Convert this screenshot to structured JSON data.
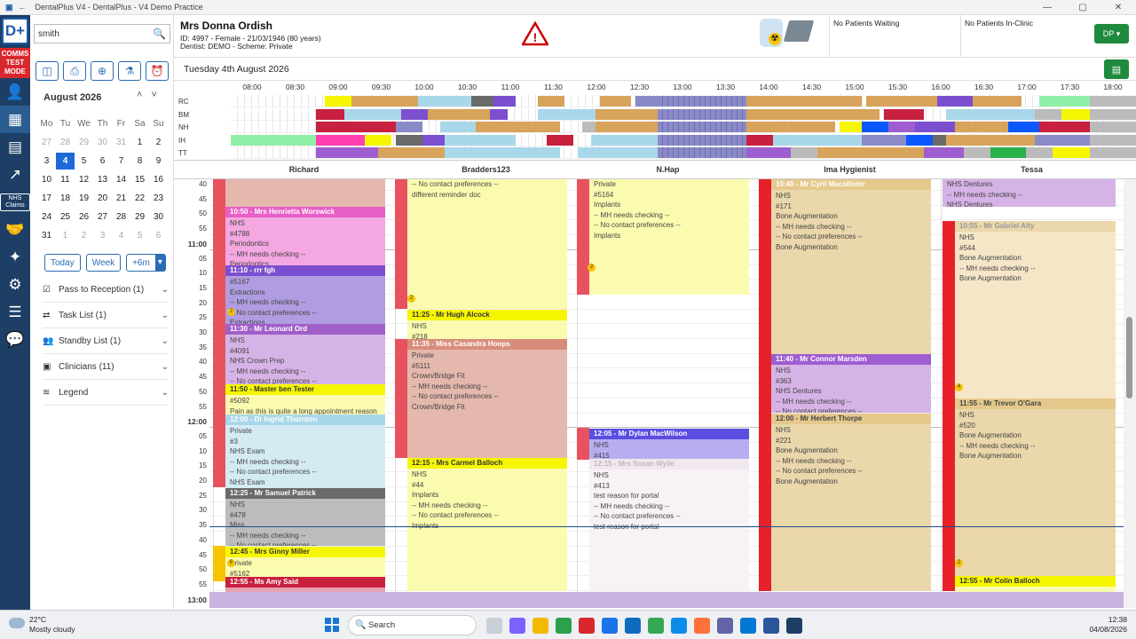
{
  "window": {
    "title": "DentalPlus V4 - DentalPlus - V4 Demo Practice"
  },
  "sidebar": {
    "comms_label": "COMMS TEST MODE",
    "nhs_label": "NHS Claims"
  },
  "search": {
    "value": "smith"
  },
  "calendar": {
    "month_label": "August 2026",
    "weekdays": [
      "Mo",
      "Tu",
      "We",
      "Th",
      "Fr",
      "Sa",
      "Su"
    ],
    "weeks": [
      [
        "27",
        "28",
        "29",
        "30",
        "31",
        "1",
        "2"
      ],
      [
        "3",
        "4",
        "5",
        "6",
        "7",
        "8",
        "9"
      ],
      [
        "10",
        "11",
        "12",
        "13",
        "14",
        "15",
        "16"
      ],
      [
        "17",
        "18",
        "19",
        "20",
        "21",
        "22",
        "23"
      ],
      [
        "24",
        "25",
        "26",
        "27",
        "28",
        "29",
        "30"
      ],
      [
        "31",
        "1",
        "2",
        "3",
        "4",
        "5",
        "6"
      ]
    ]
  },
  "nav": {
    "today": "Today",
    "week": "Week",
    "plus": "+6m"
  },
  "panels": [
    {
      "label": "Pass to Reception (1)"
    },
    {
      "label": "Task List (1)"
    },
    {
      "label": "Standby List (1)"
    },
    {
      "label": "Clinicians (11)"
    },
    {
      "label": "Legend"
    }
  ],
  "patient": {
    "name": "Mrs Donna Ordish",
    "line1": "ID: 4997 - Female - 21/03/1946 (80 years)",
    "line2": "Dentist: DEMO - Scheme: Private"
  },
  "waiting": {
    "waiting": "No Patients Waiting",
    "inclinic": "No Patients In-Clinic"
  },
  "user": {
    "initials": "DP"
  },
  "date_label": "Tuesday 4th August 2026",
  "timeline": {
    "hours": [
      "08:00",
      "08:30",
      "09:00",
      "09:30",
      "10:00",
      "10:30",
      "11:00",
      "11:30",
      "12:00",
      "12:30",
      "13:00",
      "13:30",
      "14:00",
      "14:30",
      "15:00",
      "15:30",
      "16:00",
      "16:30",
      "17:00",
      "17:30",
      "18:00"
    ],
    "rows": [
      "RC",
      "BM",
      "NH",
      "IH",
      "TT"
    ]
  },
  "columns": [
    "Richard",
    "Bradders123",
    "N.Hap",
    "Ima Hygienist",
    "Tessa"
  ],
  "times": {
    "r40": "40",
    "r50": "50",
    "r55": "55",
    "h11": "11:00",
    "r05": "05",
    "r10": "10",
    "r15": "15",
    "r20": "20",
    "r25": "25",
    "r30": "30",
    "r35": "35",
    "r45": "45",
    "h12": "12:00",
    "s05": "05",
    "s10": "10",
    "s15": "15",
    "s20": "20",
    "s25": "25",
    "s30": "30",
    "s35": "35",
    "s40": "40",
    "s45": "45",
    "s50": "50",
    "s55": "55",
    "h13": "13:00",
    "s40b": "40"
  },
  "appts": {
    "a1": {
      "head": "",
      "lines": []
    },
    "a2": {
      "head": "10:50 - Mrs Henrietta Worswick",
      "lines": [
        "NHS",
        "#4788",
        "Periodontics",
        "-- MH needs checking --",
        "Periodontics"
      ]
    },
    "a3": {
      "head": "11:10 - rrr fgh",
      "lines": [
        "#5167",
        "Extractions",
        "-- MH needs checking --",
        "-- No contact preferences --",
        "Extractions"
      ]
    },
    "a4": {
      "head": "11:30 - Mr Leonard Ord",
      "lines": [
        "NHS",
        "#4091",
        "NHS Crown Prep",
        "-- MH needs checking --",
        "-- No contact preferences --"
      ]
    },
    "a5": {
      "head": "11:50 - Master ben Tester",
      "lines": [
        "#5092",
        "Pain as this is quite a long appointment reason"
      ]
    },
    "a6": {
      "head": "12:00 - Dr Ingrid Thornton",
      "lines": [
        "Private",
        "#3",
        "NHS Exam",
        "-- MH needs checking --",
        "-- No contact preferences --",
        "NHS Exam"
      ]
    },
    "a7": {
      "head": "12:25 - Mr Samuel Patrick",
      "lines": [
        "NHS",
        "#478",
        "Miss",
        "-- MH needs checking --",
        "-- No contact preferences --"
      ]
    },
    "a8": {
      "head": "12:45 - Mrs Ginny Miller",
      "lines": [
        "Private",
        "#5162"
      ]
    },
    "a9": {
      "head": "12:55 - Ms Amy Said",
      "lines": []
    },
    "b1": {
      "head": "",
      "lines": [
        "-- No contact preferences --",
        "different reminder doc"
      ]
    },
    "b2": {
      "head": "11:25 - Mr Hugh Alcock",
      "lines": [
        "NHS",
        "#218"
      ]
    },
    "b3": {
      "head": "11:35 - Miss Casandra Hoops",
      "lines": [
        "Private",
        "#5111",
        "Crown/Bridge Fit",
        "-- MH needs checking --",
        "-- No contact preferences --",
        "Crown/Bridge Fit"
      ]
    },
    "b4": {
      "head": "12:15 - Mrs Carmel Balloch",
      "lines": [
        "NHS",
        "#44",
        "Implants",
        "-- MH needs checking --",
        "-- No contact preferences --",
        "Implants"
      ]
    },
    "n1": {
      "head": "",
      "lines": [
        "Private",
        "#5164",
        "Implants",
        "-- MH needs checking --",
        "-- No contact preferences --",
        "Implants"
      ]
    },
    "n2": {
      "head": "12:05 - Mr Dylan MacWilson",
      "lines": [
        "NHS",
        "#415"
      ]
    },
    "n3": {
      "head": "12:15 - Mrs Susan Wylie",
      "lines": [
        "NHS",
        "#413",
        "test reason for portal",
        "-- MH needs checking --",
        "-- No contact preferences --",
        "test reason for portal"
      ]
    },
    "i1": {
      "head": "10:40 - Mr Cyril Macallister",
      "lines": [
        "NHS",
        "#171",
        "Bone Augmentation",
        "-- MH needs checking --",
        "-- No contact preferences --",
        "Bone Augmentation"
      ]
    },
    "i2": {
      "head": "11:40 - Mr Connor Marsden",
      "lines": [
        "NHS",
        "#363",
        "NHS Dentures",
        "-- MH needs checking --",
        "-- No contact preferences --"
      ]
    },
    "i3": {
      "head": "12:00 - Mr Herbert Thorpe",
      "lines": [
        "NHS",
        "#221",
        "Bone Augmentation",
        "-- MH needs checking --",
        "-- No contact preferences --",
        "Bone Augmentation"
      ]
    },
    "t1": {
      "head": "",
      "lines": [
        "NHS Dentures",
        "-- MH needs checking --",
        "NHS Dentures"
      ]
    },
    "t2": {
      "head": "10:55 - Mr Gabriel Alty",
      "lines": [
        "NHS",
        "#544",
        "Bone Augmentation",
        "-- MH needs checking --",
        "Bone Augmentation"
      ]
    },
    "t3": {
      "head": "11:55 - Mr Trevor O'Gara",
      "lines": [
        "NHS",
        "#520",
        "Bone Augmentation",
        "-- MH needs checking --",
        "Bone Augmentation"
      ]
    },
    "t4": {
      "head": "12:55 - Mr Colin Balloch",
      "lines": []
    }
  },
  "taskbar": {
    "temp": "22°C",
    "weather": "Mostly cloudy",
    "search": "Search",
    "time": "12:38",
    "date": "04/08/2026"
  },
  "colors": {
    "brand": "#1d3f66",
    "accent": "#1f8a3d",
    "selected": "#1d6ad8"
  }
}
